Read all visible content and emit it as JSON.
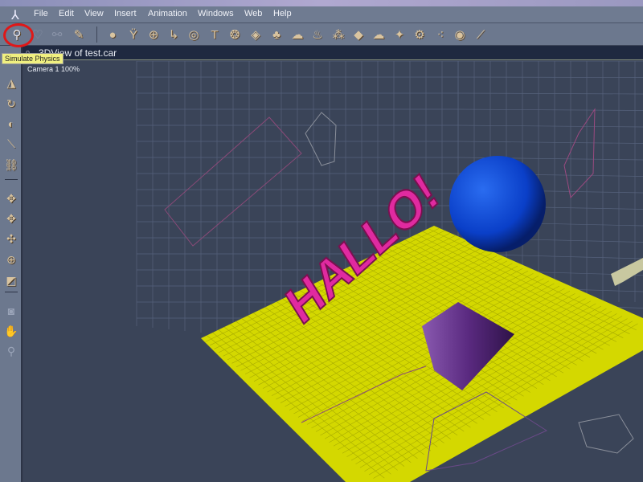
{
  "menu": {
    "items": [
      "File",
      "Edit",
      "View",
      "Insert",
      "Animation",
      "Windows",
      "Web",
      "Help"
    ]
  },
  "toolbar": {
    "tools": [
      "simulate-physics-icon",
      "physics-disabled-icon",
      "physics-disabled-2-icon",
      "render-icon",
      "sphere-icon",
      "goblet-icon",
      "globe-icon",
      "pipe-icon",
      "torus-icon",
      "text-icon",
      "particles-icon",
      "terrain-icon",
      "tree-icon",
      "smoke-icon",
      "fire-icon",
      "stones-icon",
      "landscape-icon",
      "cloud-icon",
      "light-icon",
      "camera-icon",
      "skeleton-icon",
      "target-icon",
      "bone-icon"
    ]
  },
  "tooltip": "Simulate Physics",
  "window": {
    "title": "3DView of test.car",
    "camera_label": "Camera 1 100%"
  },
  "left_tools": [
    "select-icon",
    "move-icon",
    "rotate-icon",
    "twist-icon",
    "paint-icon",
    "link-icon",
    "move-xy-icon",
    "move-xz-icon",
    "move-yz-icon",
    "rotate-trackball-icon",
    "box-icon",
    "camera-icon",
    "pan-hand-icon",
    "zoom-icon"
  ],
  "scene": {
    "text_object": "HALLO!",
    "colors": {
      "floor": "#d4d800",
      "sphere": "#0a3fc8",
      "text": "#e02aa0",
      "cone": "#5a2a80",
      "background": "#3a4458"
    }
  }
}
